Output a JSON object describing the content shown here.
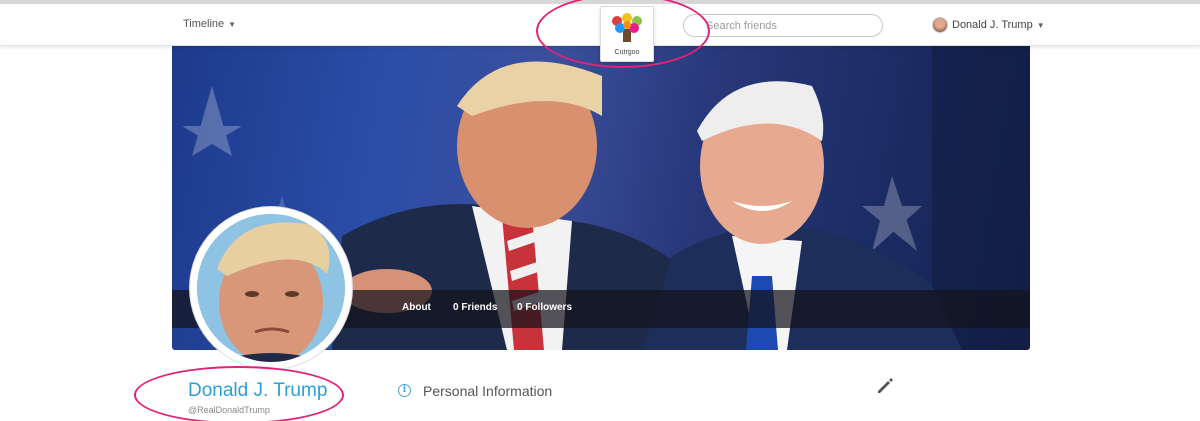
{
  "nav": {
    "timeline_label": "Timeline",
    "logo_text": "Cutrgoo",
    "search_placeholder": "Search friends",
    "user_name": "Donald J. Trump"
  },
  "cover": {
    "menu": [
      {
        "label": "About"
      },
      {
        "label": "0 Friends"
      },
      {
        "label": "0 Followers"
      }
    ]
  },
  "profile": {
    "name": "Donald J. Trump",
    "handle": "@RealDonaldTrump"
  },
  "section": {
    "title": "Personal Information"
  },
  "colors": {
    "accent": "#2a9fd8",
    "annotation": "#e0247a"
  },
  "icons": [
    "caret-down-icon",
    "logo-tree-icon",
    "info-icon",
    "edit-pencil-icon"
  ]
}
